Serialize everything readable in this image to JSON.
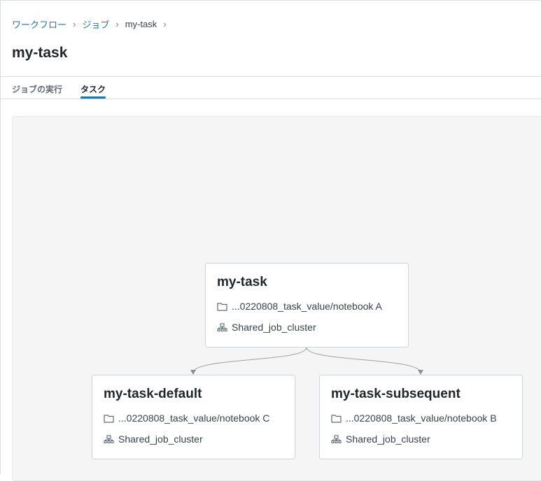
{
  "breadcrumb": {
    "items": [
      "ワークフロー",
      "ジョブ",
      "my-task"
    ],
    "separator": "›"
  },
  "page": {
    "title": "my-task"
  },
  "tabs": [
    {
      "label": "ジョブの実行",
      "active": false
    },
    {
      "label": "タスク",
      "active": true
    }
  ],
  "colors": {
    "accent": "#2272b4",
    "canvas_bg": "#f5f5f5",
    "edge": "#9aa0a6"
  },
  "graph": {
    "nodes": [
      {
        "id": "my-task",
        "title": "my-task",
        "notebook": "...0220808_task_value/notebook A",
        "cluster": "Shared_job_cluster",
        "notebook_icon": "folder-icon",
        "cluster_icon": "cluster-icon"
      },
      {
        "id": "my-task-default",
        "title": "my-task-default",
        "notebook": "...0220808_task_value/notebook C",
        "cluster": "Shared_job_cluster",
        "notebook_icon": "folder-icon",
        "cluster_icon": "cluster-icon"
      },
      {
        "id": "my-task-subsequent",
        "title": "my-task-subsequent",
        "notebook": "...0220808_task_value/notebook B",
        "cluster": "Shared_job_cluster",
        "notebook_icon": "folder-icon",
        "cluster_icon": "cluster-icon"
      }
    ],
    "edges": [
      {
        "from": "my-task",
        "to": "my-task-default"
      },
      {
        "from": "my-task",
        "to": "my-task-subsequent"
      }
    ]
  }
}
